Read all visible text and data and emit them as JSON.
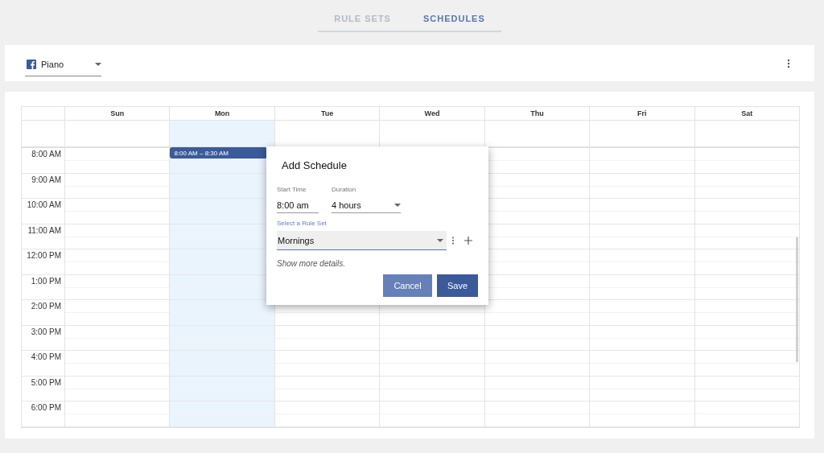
{
  "tabs": [
    {
      "label": "RULE SETS",
      "selected": false
    },
    {
      "label": "SCHEDULES",
      "selected": true
    }
  ],
  "account": {
    "value": "Piano"
  },
  "calendar": {
    "days": [
      {
        "label": "Sun",
        "selected": false
      },
      {
        "label": "Mon",
        "selected": true,
        "events": [
          {
            "label": "8:00 AM – 8:30 AM"
          }
        ]
      },
      {
        "label": "Tue",
        "selected": false
      },
      {
        "label": "Wed",
        "selected": false
      },
      {
        "label": "Thu",
        "selected": false
      },
      {
        "label": "Fri",
        "selected": false
      },
      {
        "label": "Sat",
        "selected": false
      }
    ],
    "times": [
      "8:00 AM",
      "9:00 AM",
      "10:00 AM",
      "11:00 AM",
      "12:00 PM",
      "1:00 PM",
      "2:00 PM",
      "3:00 PM",
      "4:00 PM",
      "5:00 PM",
      "6:00 PM"
    ]
  },
  "dialog": {
    "title": "Add Schedule",
    "start_time": {
      "label": "Start Time",
      "value": "8:00 am"
    },
    "duration": {
      "label": "Duration",
      "value": "4 hours"
    },
    "rule_set": {
      "label": "Select a Rule Set",
      "value": "Mornings"
    },
    "details_link": "Show more details.",
    "buttons": [
      {
        "label": "Cancel",
        "kind": "secondary"
      },
      {
        "label": "Save",
        "kind": "primary"
      }
    ]
  }
}
